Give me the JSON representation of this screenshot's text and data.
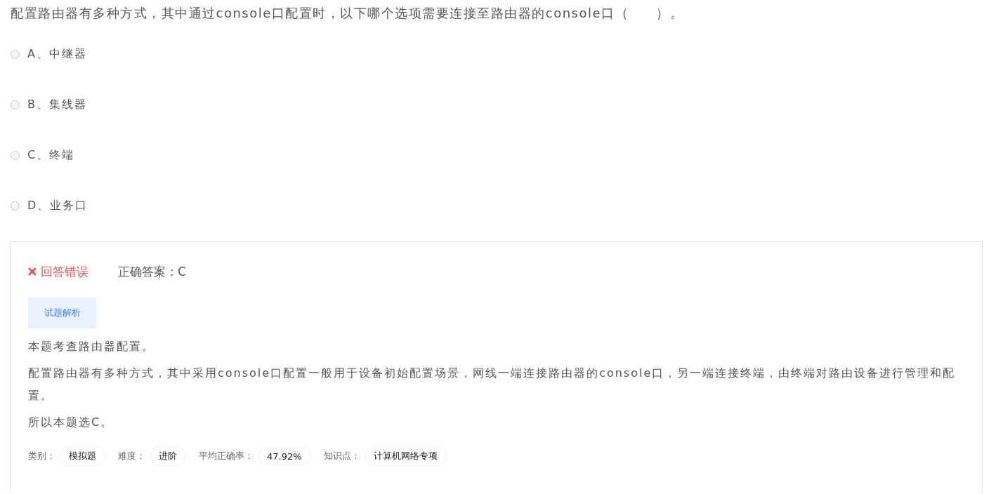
{
  "question": {
    "text": "配置路由器有多种方式，其中通过console口配置时，以下哪个选项需要连接至路由器的console口（　　）。"
  },
  "options": [
    {
      "label": "A、中继器",
      "selected": false
    },
    {
      "label": "B、集线器",
      "selected": false
    },
    {
      "label": "C、终端",
      "selected": false
    },
    {
      "label": "D、业务口",
      "selected": false
    }
  ],
  "result": {
    "correct": false,
    "verdict": "回答错误",
    "correct_answer": "正确答案：C"
  },
  "analysis_button": "试题解析",
  "analysis": [
    "本题考查路由器配置。",
    "配置路由器有多种方式，其中采用console口配置一般用于设备初始配置场景，网线一端连接路由器的console口，另一端连接终端，由终端对路由设备进行管理和配置。",
    "所以本题选C。"
  ],
  "meta": [
    {
      "label": "类别：",
      "value": "模拟题"
    },
    {
      "label": "难度：",
      "value": "进阶"
    },
    {
      "label": "平均正确率：",
      "value": "47.92%"
    },
    {
      "label": "知识点：",
      "value": "计算机网络专项"
    }
  ]
}
